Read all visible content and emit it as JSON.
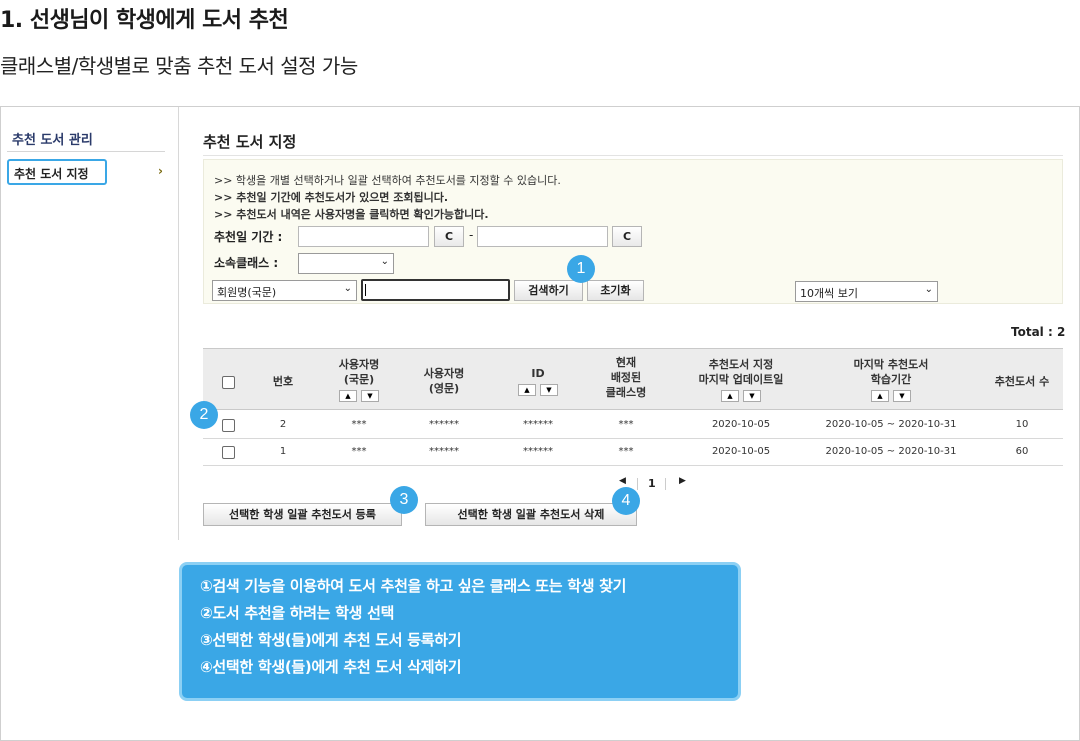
{
  "page": {
    "title": "1. 선생님이 학생에게 도서 추천",
    "subtitle": "클래스별/학생별로 맞춤 추천 도서 설정 가능"
  },
  "sidebar": {
    "title": "추천 도서 관리",
    "items": [
      {
        "label": "추천 도서 지정",
        "chevron": "›"
      }
    ]
  },
  "main": {
    "title": "추천 도서 지정",
    "notices": [
      ">> 학생을 개별 선택하거나 일괄 선택하여 추천도서를 지정할 수 있습니다.",
      ">> 추천일 기간에 추천도서가 있으면 조회됩니다.",
      ">> 추천도서 내역은 사용자명을 클릭하면 확인가능합니다."
    ],
    "filters": {
      "date_label": "추천일 기간 :",
      "clear_label": "C",
      "date_separator": "-",
      "class_label": "소속클래스 :",
      "class_value": "",
      "member_select": "회원명(국문)",
      "search_value": "",
      "search_button": "검색하기",
      "reset_button": "초기화",
      "view_select": "10개씩 보기"
    },
    "total": "Total : 2",
    "table": {
      "headers": {
        "no": "번호",
        "name_kr": [
          "사용자명",
          "(국문)"
        ],
        "name_en": [
          "사용자명",
          "(영문)"
        ],
        "id": "ID",
        "class": [
          "현재",
          "배정된",
          "클래스명"
        ],
        "updated": [
          "추천도서 지정",
          "마지막 업데이트일"
        ],
        "period": [
          "마지막 추천도서",
          "학습기간"
        ],
        "count": "추천도서 수"
      },
      "sort_up": "▲",
      "sort_down": "▼",
      "rows": [
        {
          "no": "2",
          "name_kr": "***",
          "name_en": "******",
          "id": "******",
          "class": "***",
          "updated": "2020-10-05",
          "period": "2020-10-05 ~ 2020-10-31",
          "count": "10"
        },
        {
          "no": "1",
          "name_kr": "***",
          "name_en": "******",
          "id": "******",
          "class": "***",
          "updated": "2020-10-05",
          "period": "2020-10-05 ~ 2020-10-31",
          "count": "60"
        }
      ]
    },
    "pagination": {
      "prev": "◀",
      "current": "1",
      "next": "▶"
    },
    "actions": {
      "register": "선택한 학생 일괄 추천도서 등록",
      "delete": "선택한 학생 일괄 추천도서 삭제"
    }
  },
  "badges": [
    "1",
    "2",
    "3",
    "4"
  ],
  "callout": {
    "lines": [
      "①검색 기능을 이용하여 도서 추천을 하고 싶은 클래스 또는 학생 찾기",
      "②도서 추천을 하려는 학생 선택",
      "③선택한 학생(들)에게 추천 도서 등록하기",
      "④선택한 학생(들)에게 추천 도서 삭제하기"
    ]
  },
  "colors": {
    "accent": "#3aa7e6",
    "callout_border": "#8cd0f4",
    "filter_bg": "#fbfbf1",
    "header_bg": "#ececec"
  }
}
